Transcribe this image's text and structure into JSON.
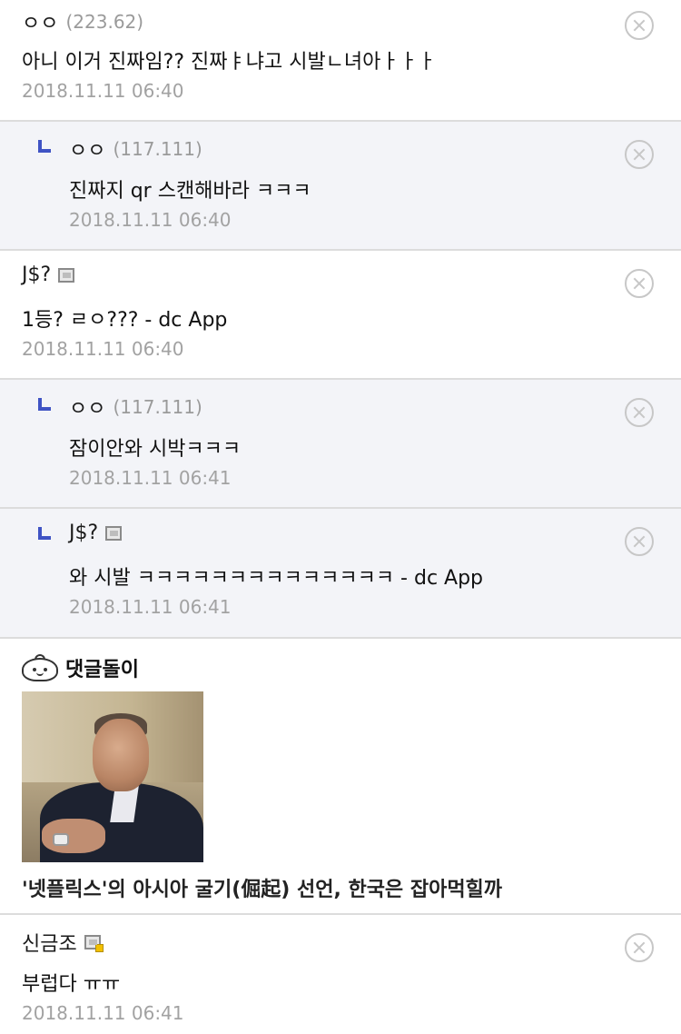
{
  "comments": [
    {
      "author": "ㅇㅇ",
      "ip": "(223.62)",
      "text": "아니 이거 진짜임?? 진짜ㅑ냐고 시발ㄴ녀아ㅏㅏㅏ",
      "date": "2018.11.11 06:40"
    },
    {
      "author": "ㅇㅇ",
      "ip": "(117.111)",
      "text": "진짜지 qr 스캔해바라 ㅋㅋㅋ",
      "date": "2018.11.11 06:40"
    },
    {
      "author": "J$?",
      "text": "1등? ㄹㅇ??? - dc App",
      "date": "2018.11.11 06:40"
    },
    {
      "author": "ㅇㅇ",
      "ip": "(117.111)",
      "text": "잠이안와 시박ㅋㅋㅋ",
      "date": "2018.11.11 06:41"
    },
    {
      "author": "J$?",
      "text": "와 시발 ㅋㅋㅋㅋㅋㅋㅋㅋㅋㅋㅋㅋㅋㅋ - dc App",
      "date": "2018.11.11 06:41"
    },
    {
      "author": "신금조",
      "text": "부럽다 ㅠㅠ",
      "date": "2018.11.11 06:41"
    }
  ],
  "promo": {
    "label": "댓글돌이",
    "caption": "'넷플릭스'의 아시아 굴기(倔起) 선언, 한국은 잡아먹힐까"
  },
  "icons": {
    "delete": "close-circle-icon",
    "reply": "reply-corner-icon",
    "app_badge": "mobile-app-icon",
    "promo": "dumpling-mascot-icon"
  },
  "colors": {
    "reply_bg": "#f3f4f8",
    "reply_mark": "#3f53c4",
    "meta_text": "#a2a2a2"
  }
}
